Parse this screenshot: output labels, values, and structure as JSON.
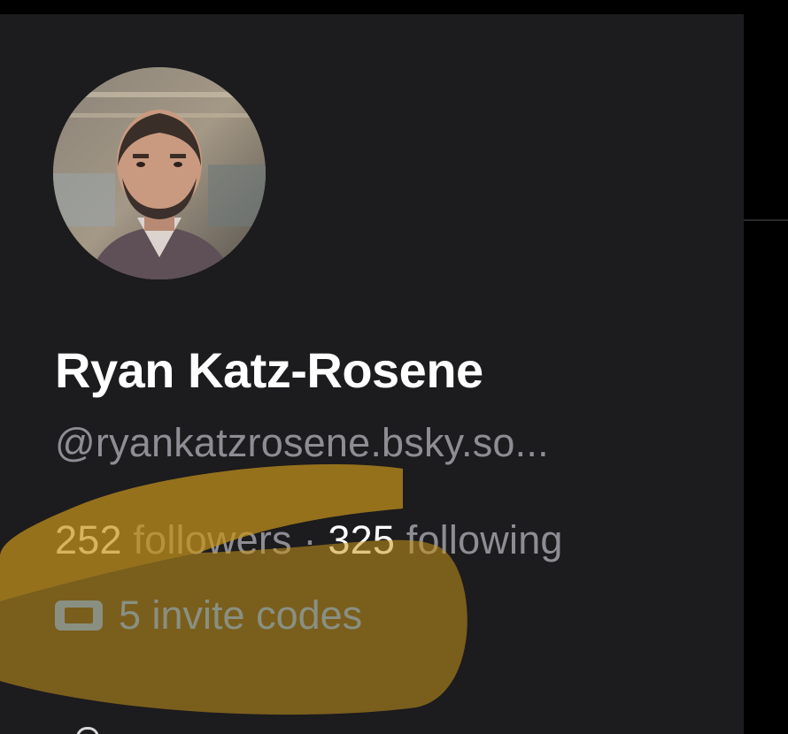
{
  "profile": {
    "display_name": "Ryan Katz-Rosene",
    "handle": "@ryankatzrosene.bsky.so...",
    "followers_count": "252",
    "followers_label": " followers",
    "separator": " · ",
    "following_count": "325",
    "following_label": " following",
    "invite_codes_label": "5 invite codes"
  },
  "icons": {
    "avatar": "profile-photo",
    "invite": "ticket-icon"
  },
  "colors": {
    "background": "#1c1b1e",
    "text_primary": "#ffffff",
    "text_secondary": "#8e8d93",
    "link": "#3d8bff",
    "highlighter": "#c9961c"
  }
}
